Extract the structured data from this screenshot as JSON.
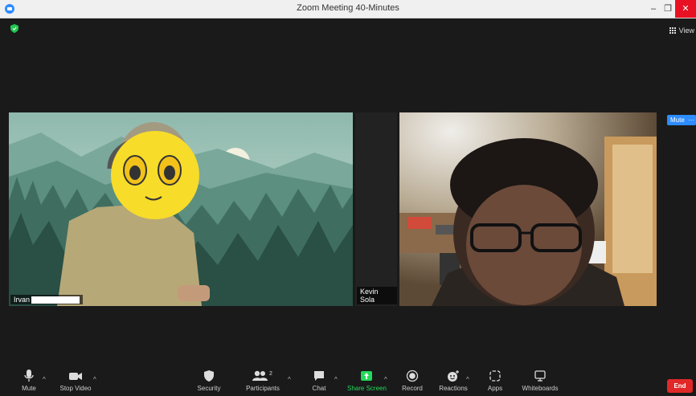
{
  "window": {
    "title": "Zoom Meeting 40-Minutes",
    "minimize": "–",
    "restore": "❐",
    "close": "✕"
  },
  "header": {
    "view_label": "View"
  },
  "participants": {
    "left": {
      "name_visible": "Irvan"
    },
    "right": {
      "name": "Kevin Sola"
    }
  },
  "tile_controls": {
    "mute_label": "Mute",
    "more_label": "···"
  },
  "toolbar": {
    "mute": "Mute",
    "stop_video": "Stop Video",
    "security": "Security",
    "participants": "Participants",
    "participants_count": "2",
    "chat": "Chat",
    "share_screen": "Share Screen",
    "record": "Record",
    "reactions": "Reactions",
    "apps": "Apps",
    "whiteboards": "Whiteboards",
    "end": "End"
  },
  "colors": {
    "accent": "#2d8cff",
    "share": "#23d959",
    "end": "#e02828",
    "close": "#e81123"
  }
}
